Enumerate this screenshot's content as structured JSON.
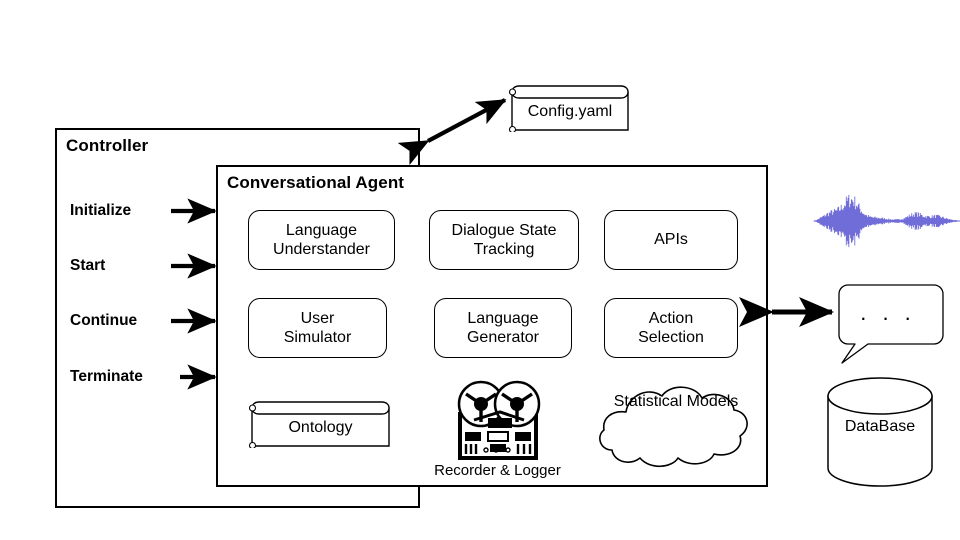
{
  "diagram": {
    "controller": {
      "title": "Controller",
      "commands": [
        {
          "label": "Initialize",
          "name": "initialize"
        },
        {
          "label": "Start",
          "name": "start"
        },
        {
          "label": "Continue",
          "name": "continue"
        },
        {
          "label": "Terminate",
          "name": "terminate"
        }
      ]
    },
    "agent": {
      "title": "Conversational Agent",
      "modules": [
        {
          "name": "language-understander",
          "line1": "Language",
          "line2": "Understander"
        },
        {
          "name": "dialogue-state-tracking",
          "line1": "Dialogue State",
          "line2": "Tracking"
        },
        {
          "name": "apis",
          "line1": "APIs",
          "line2": ""
        },
        {
          "name": "user-simulator",
          "line1": "User",
          "line2": "Simulator"
        },
        {
          "name": "language-generator",
          "line1": "Language",
          "line2": "Generator"
        },
        {
          "name": "action-selection",
          "line1": "Action",
          "line2": "Selection"
        }
      ],
      "ontology_label": "Ontology",
      "recorder_caption": "Recorder & Logger",
      "statistical_models": {
        "line1": "Statistical",
        "line2": "Models"
      }
    },
    "config": {
      "label": "Config.yaml"
    },
    "external": {
      "waveform_icon": "audio-waveform-icon",
      "speech_bubble_text": ". . .",
      "database_label": "DataBase"
    },
    "colors": {
      "stroke": "#000000",
      "background": "#ffffff",
      "waveform": "#6a66d6"
    }
  }
}
